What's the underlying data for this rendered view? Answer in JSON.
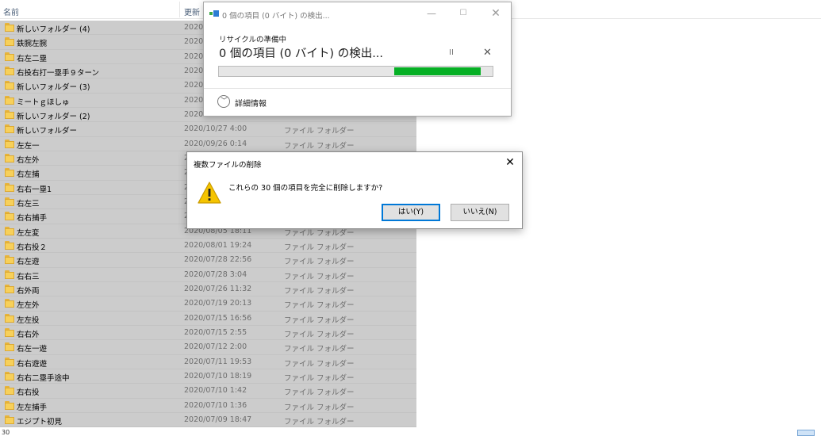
{
  "columns": {
    "name": "名前",
    "date": "更新"
  },
  "files": [
    {
      "name": "新しいフォルダー (4)",
      "date": "2020",
      "type": ""
    },
    {
      "name": "鉄腕左腕",
      "date": "2020",
      "type": ""
    },
    {
      "name": "右左二塁",
      "date": "2020",
      "type": ""
    },
    {
      "name": "右投右打一塁手９ターン",
      "date": "2020",
      "type": ""
    },
    {
      "name": "新しいフォルダー (3)",
      "date": "2020",
      "type": ""
    },
    {
      "name": "ミートｇほしゅ",
      "date": "2020",
      "type": ""
    },
    {
      "name": "新しいフォルダー (2)",
      "date": "2020",
      "type": ""
    },
    {
      "name": "新しいフォルダー",
      "date": "2020/10/27 4:00",
      "type": "ファイル フォルダー"
    },
    {
      "name": "左左一",
      "date": "2020/09/26 0:14",
      "type": "ファイル フォルダー"
    },
    {
      "name": "右左外",
      "date": "2",
      "type": ""
    },
    {
      "name": "右左捕",
      "date": "2",
      "type": ""
    },
    {
      "name": "右右一塁1",
      "date": "2",
      "type": ""
    },
    {
      "name": "右左三",
      "date": "2",
      "type": ""
    },
    {
      "name": "右右捕手",
      "date": "2",
      "type": ""
    },
    {
      "name": "左左変",
      "date": "2020/08/05 18:11",
      "type": "ファイル フォルダー"
    },
    {
      "name": "右右投２",
      "date": "2020/08/01 19:24",
      "type": "ファイル フォルダー"
    },
    {
      "name": "右左遊",
      "date": "2020/07/28 22:56",
      "type": "ファイル フォルダー"
    },
    {
      "name": "右右三",
      "date": "2020/07/28 3:04",
      "type": "ファイル フォルダー"
    },
    {
      "name": "右外両",
      "date": "2020/07/26 11:32",
      "type": "ファイル フォルダー"
    },
    {
      "name": "左左外",
      "date": "2020/07/19 20:13",
      "type": "ファイル フォルダー"
    },
    {
      "name": "左左投",
      "date": "2020/07/15 16:56",
      "type": "ファイル フォルダー"
    },
    {
      "name": "右右外",
      "date": "2020/07/15 2:55",
      "type": "ファイル フォルダー"
    },
    {
      "name": "右左一遊",
      "date": "2020/07/12 2:00",
      "type": "ファイル フォルダー"
    },
    {
      "name": "右右遊遊",
      "date": "2020/07/11 19:53",
      "type": "ファイル フォルダー"
    },
    {
      "name": "右右二塁手途中",
      "date": "2020/07/10 18:19",
      "type": "ファイル フォルダー"
    },
    {
      "name": "右右投",
      "date": "2020/07/10 1:42",
      "type": "ファイル フォルダー"
    },
    {
      "name": "左左捕手",
      "date": "2020/07/10 1:36",
      "type": "ファイル フォルダー"
    },
    {
      "name": "エジプト初見",
      "date": "2020/07/09 18:47",
      "type": "ファイル フォルダー"
    }
  ],
  "status_bar": {
    "text": "30"
  },
  "progress_dialog": {
    "title": "0 個の項目 (0 バイト) の検出...",
    "status": "リサイクルの準備中",
    "heading": "0 個の項目 (0 バイト) の検出...",
    "pause_glyph": "II",
    "cancel_glyph": "✕",
    "minimize_glyph": "—",
    "maximize_glyph": "☐",
    "close_glyph": "✕",
    "details_label": "詳細情報",
    "progress": {
      "start": 0.64,
      "end": 0.955
    },
    "bar_color": "#06b025"
  },
  "confirm_dialog": {
    "title": "複数ファイルの削除",
    "close_glyph": "✕",
    "message": "これらの 30 個の項目を完全に削除しますか?",
    "yes_label": "はい(Y)",
    "no_label": "いいえ(N)",
    "accent": "#0078d7"
  },
  "colors": {
    "selection": "#cccccc",
    "folder": "#f7d05a",
    "warning": "#f5c400"
  }
}
